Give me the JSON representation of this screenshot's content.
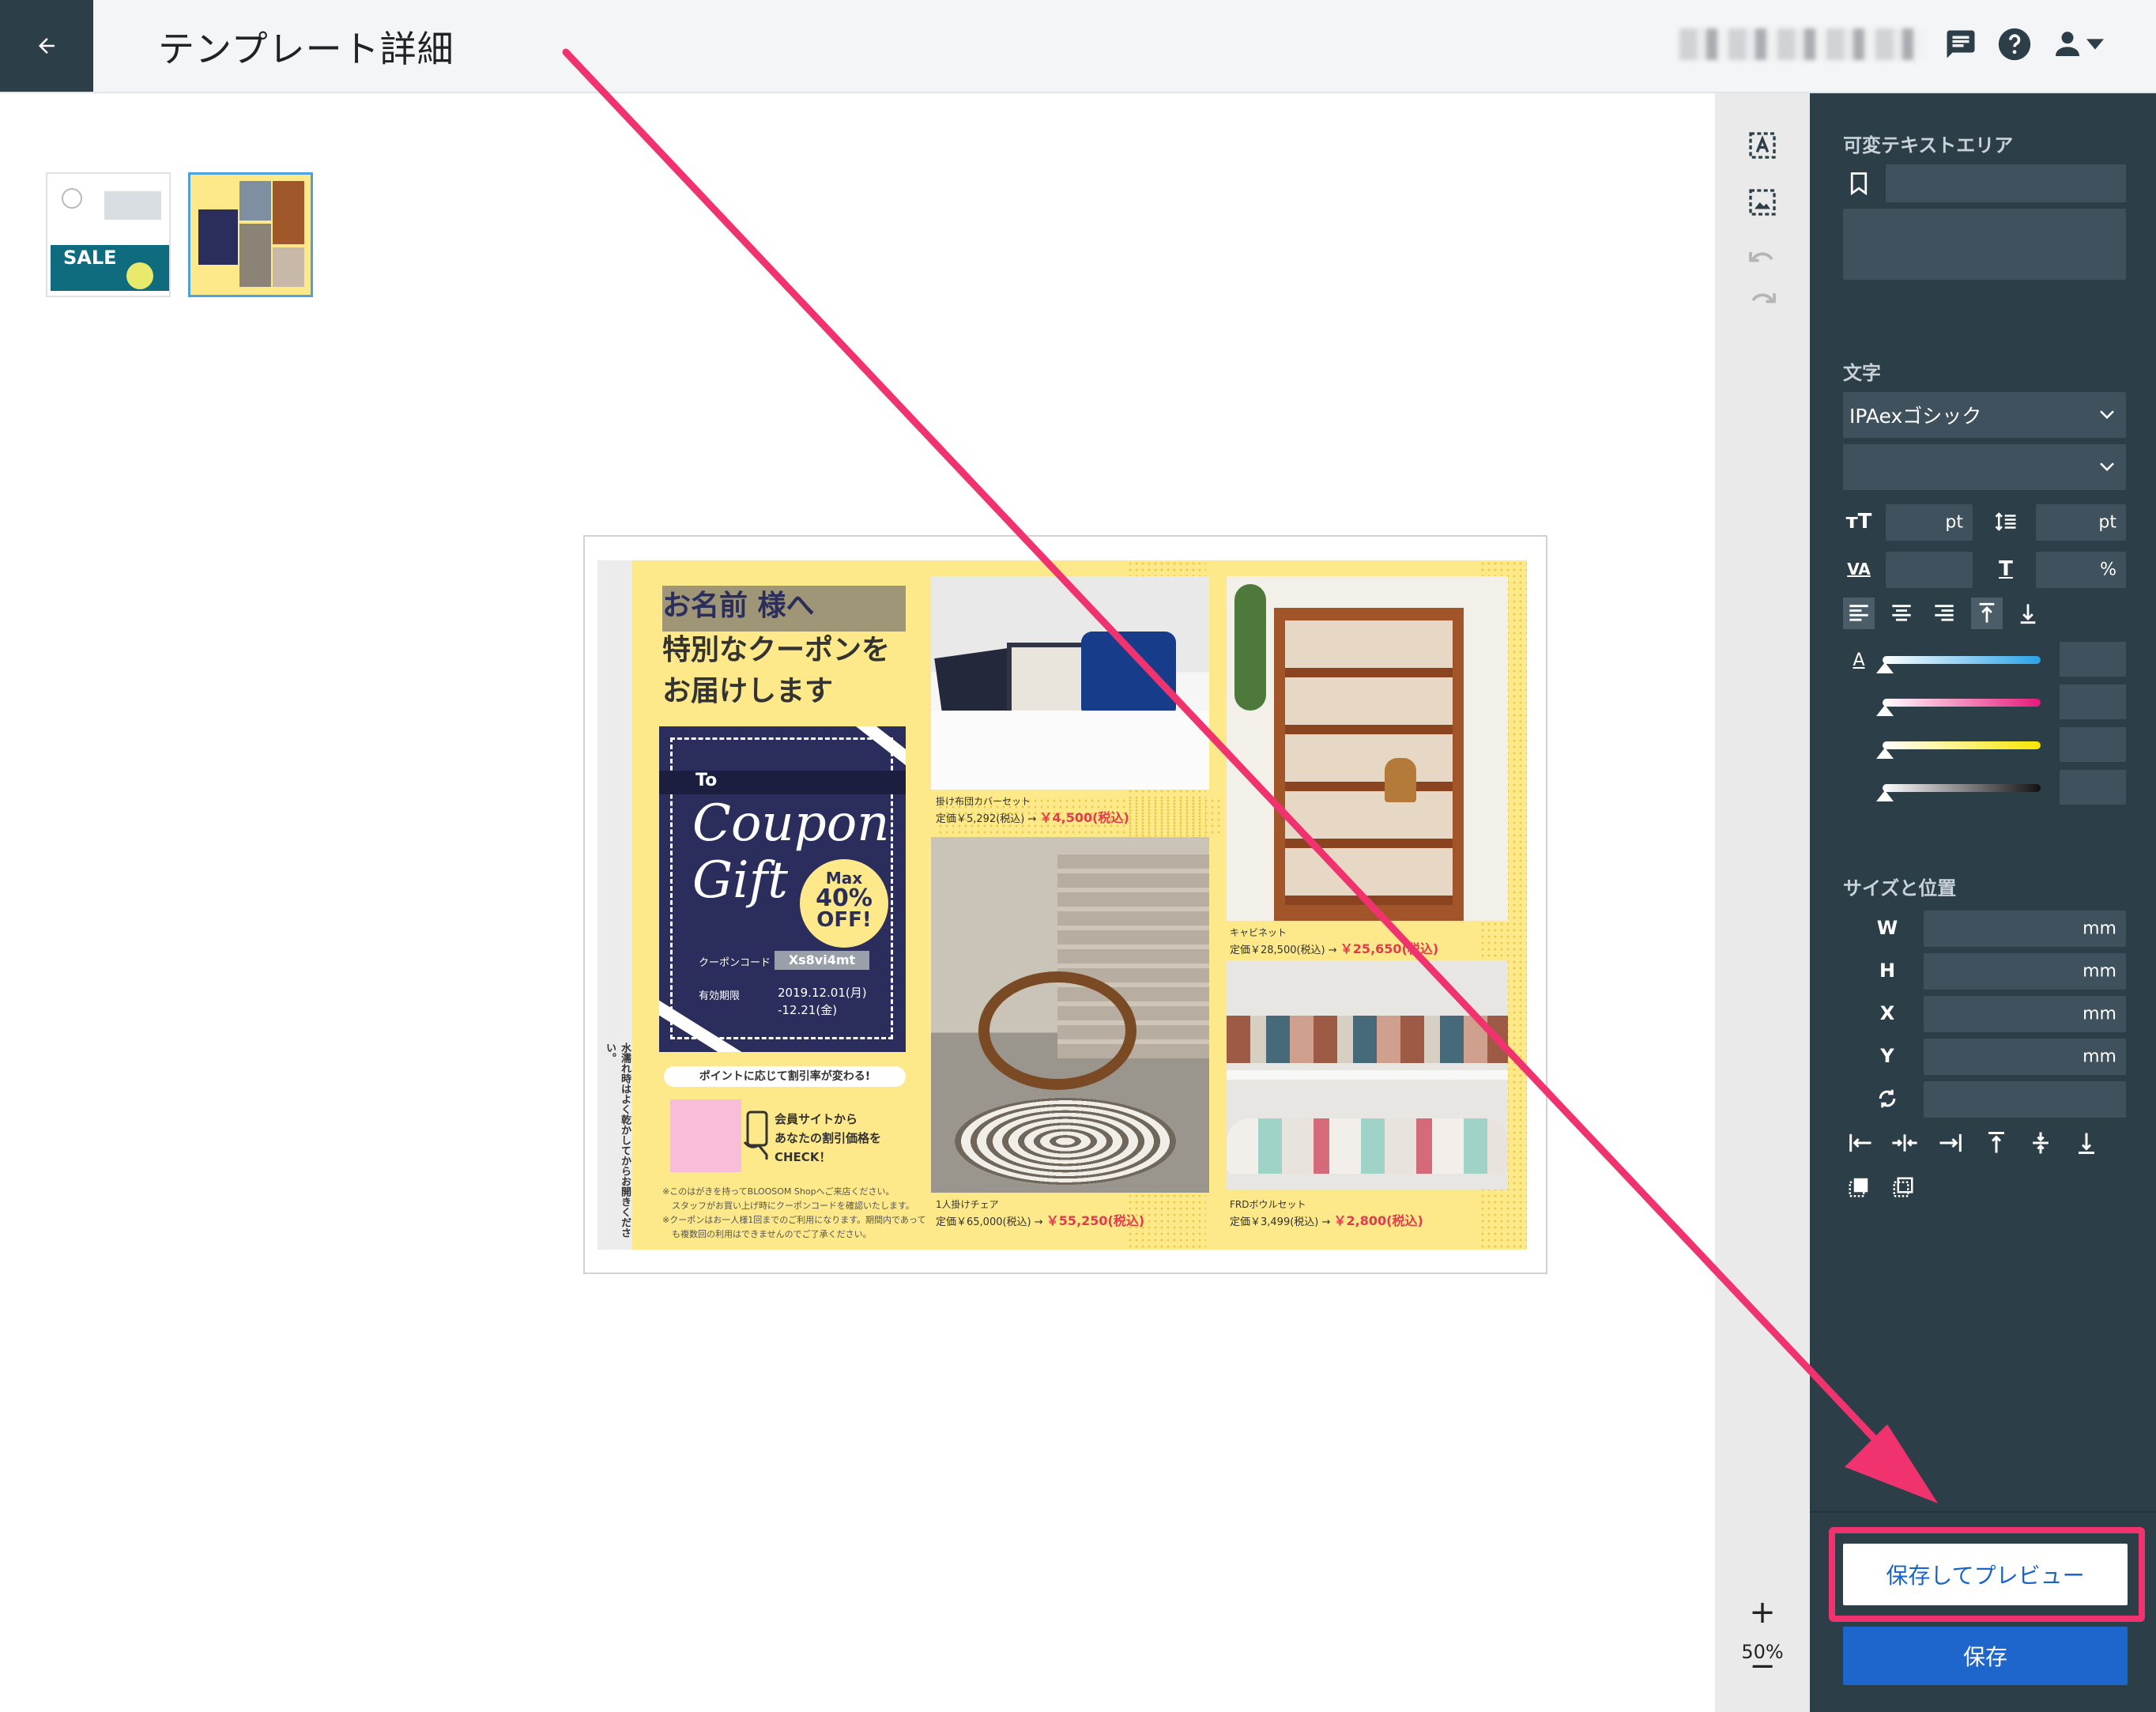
{
  "header": {
    "title": "テンプレート詳細",
    "back_icon": "arrow-left-icon",
    "icons": [
      "chat-icon",
      "help-icon",
      "user-icon",
      "caret-down-icon"
    ]
  },
  "toolstrip": {
    "zoom": "50%",
    "zoom_in": "+",
    "zoom_out": "−"
  },
  "panel": {
    "variable_text_title": "可変テキストエリア",
    "text_title": "文字",
    "font_select": "IPAexゴシック",
    "unit_pt": "pt",
    "unit_percent": "%",
    "size_title": "サイズと位置",
    "dims": [
      {
        "label": "W",
        "unit": "mm"
      },
      {
        "label": "H",
        "unit": "mm"
      },
      {
        "label": "X",
        "unit": "mm"
      },
      {
        "label": "Y",
        "unit": "mm"
      }
    ],
    "preview_button": "保存してプレビュー",
    "save_button": "保存"
  },
  "colors": {
    "dark_panel": "#2c3e48",
    "accent_blue": "#1e66cc",
    "highlight_pink": "#f0336e",
    "flyer_yellow": "#fde98a",
    "coupon_navy": "#2b2e5c"
  },
  "thumbs": {
    "t1_text": "SALE"
  },
  "flyer": {
    "name_line": "お名前 様へ",
    "line2": "特別なクーポンを",
    "line3": "お届けします",
    "to": "To",
    "coupon_word": "Coupon",
    "gift_word": "Gift",
    "badge_max": "Max",
    "badge_pct": "40%",
    "badge_off": "OFF!",
    "code_label": "クーポンコード",
    "code_value": "Xs8vi4mt",
    "valid_label": "有効期限",
    "valid_from": "2019.12.01(月)",
    "valid_to": "-12.21(金)",
    "points_pill": "ポイントに応じて割引率が変わる!",
    "member_1": "会員サイトから",
    "member_2": "あなたの割引価格を",
    "member_3": "CHECK！",
    "note_1": "※このはがきを持ってBLOOSOM Shopへご来店ください。",
    "note_2": "スタッフがお買い上げ時にクーポンコードを確認いたします。",
    "note_3": "※クーポンはお一人様1回までのご利用になります。期間内であって",
    "note_4": "も複数回の利用はできませんのでご了承ください。",
    "vertical_note": "水濡れ時はよく乾かしてからお開きください。",
    "p1_name": "掛け布団カバーセット",
    "p1_price": "定価￥5,292(税込) →",
    "p1_sale": "￥4,500(税込)",
    "p2_name": "1人掛けチェア",
    "p2_price": "定価￥65,000(税込) →",
    "p2_sale": "￥55,250(税込)",
    "p3_name": "キャビネット",
    "p3_price": "定価￥28,500(税込) →",
    "p3_sale": "￥25,650(税込)",
    "p4_name": "FRDボウルセット",
    "p4_price": "定価￥3,499(税込) →",
    "p4_sale": "￥2,800(税込)"
  }
}
